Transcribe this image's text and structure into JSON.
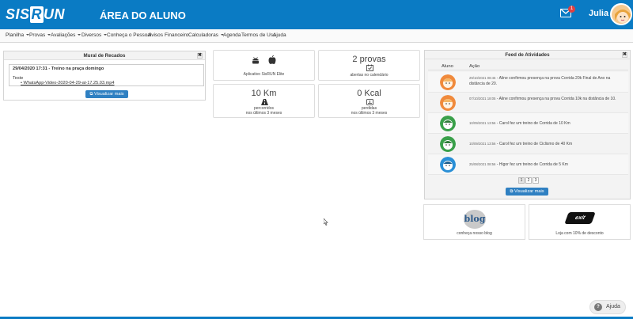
{
  "header": {
    "logo_left": "SIS",
    "logo_r": "R",
    "logo_right": "UN",
    "title": "ÁREA DO ALUNO",
    "mail_badge": "1",
    "user_name": "Julia"
  },
  "menu": [
    {
      "label": "Planilha",
      "caret": true
    },
    {
      "label": "Provas",
      "caret": true
    },
    {
      "label": "Avaliações",
      "caret": true
    },
    {
      "label": "Diversos",
      "caret": true
    },
    {
      "label": "Conheça o Pessoal",
      "caret": false
    },
    {
      "label": "Avisos",
      "caret": false
    },
    {
      "label": "Financeiro",
      "caret": false
    },
    {
      "label": "Calculadoras",
      "caret": true
    },
    {
      "label": "Agenda",
      "caret": false
    },
    {
      "label": "Termos de Uso",
      "caret": false
    },
    {
      "label": "Ajuda",
      "caret": false
    }
  ],
  "mural": {
    "title": "Mural de Recados",
    "close": "✖",
    "recado_title": "29/04/2020 17:31 - Treino na praça domingo",
    "recado_text": "Teste",
    "recado_link": "WhatsApp-Video-2020-04-29-at-17.25.03.mp4",
    "button": "Visualizar mais"
  },
  "cards": {
    "app_label": "Aplicativo SisRUN Elite",
    "provas_value": "2 provas",
    "provas_caption": "abertas no calendário",
    "km_value": "10 Km",
    "km_caption1": "percorridos",
    "km_caption2": "nos últimos 3 meses",
    "kcal_value": "0 Kcal",
    "kcal_caption1": "perdidas",
    "kcal_caption2": "nos últimos 3 meses"
  },
  "feed": {
    "title": "Feed de Atividades",
    "close": "✖",
    "col_aluno": "Aluno",
    "col_acao": "Ação",
    "rows": [
      {
        "date": "29/10/2021 08:46",
        "text": " - Aline confirmou presença na prova Corrida 20k Final de Ano na distância de 20.",
        "avatar": "orange"
      },
      {
        "date": "07/10/2021 18:05",
        "text": " - Aline confirmou presença na prova Corrida 10k na distância de 10.",
        "avatar": "orange"
      },
      {
        "date": "10/09/2021 13:56",
        "text": " - Carol fez um treino de Corrida de 10 Km",
        "avatar": "green"
      },
      {
        "date": "10/09/2021 13:56",
        "text": " - Carol fez um treino de Ciclismo de 40 Km",
        "avatar": "green"
      },
      {
        "date": "25/08/2021 08:56",
        "text": " - Higor fez um treino de Corrida de 5 Km",
        "avatar": "blue"
      }
    ],
    "pages": [
      "1",
      "2",
      "3"
    ],
    "button": "Visualizar mais"
  },
  "promos": {
    "blog_logo": "blog",
    "blog_caption": "conheça nosso blog",
    "shop_logo": "exit",
    "shop_caption": "Loja com 10% de desconto"
  },
  "help": {
    "label": "Ajuda",
    "icon": "?"
  },
  "colors": {
    "brand": "#0a7bc4",
    "button": "#2f80c2"
  }
}
